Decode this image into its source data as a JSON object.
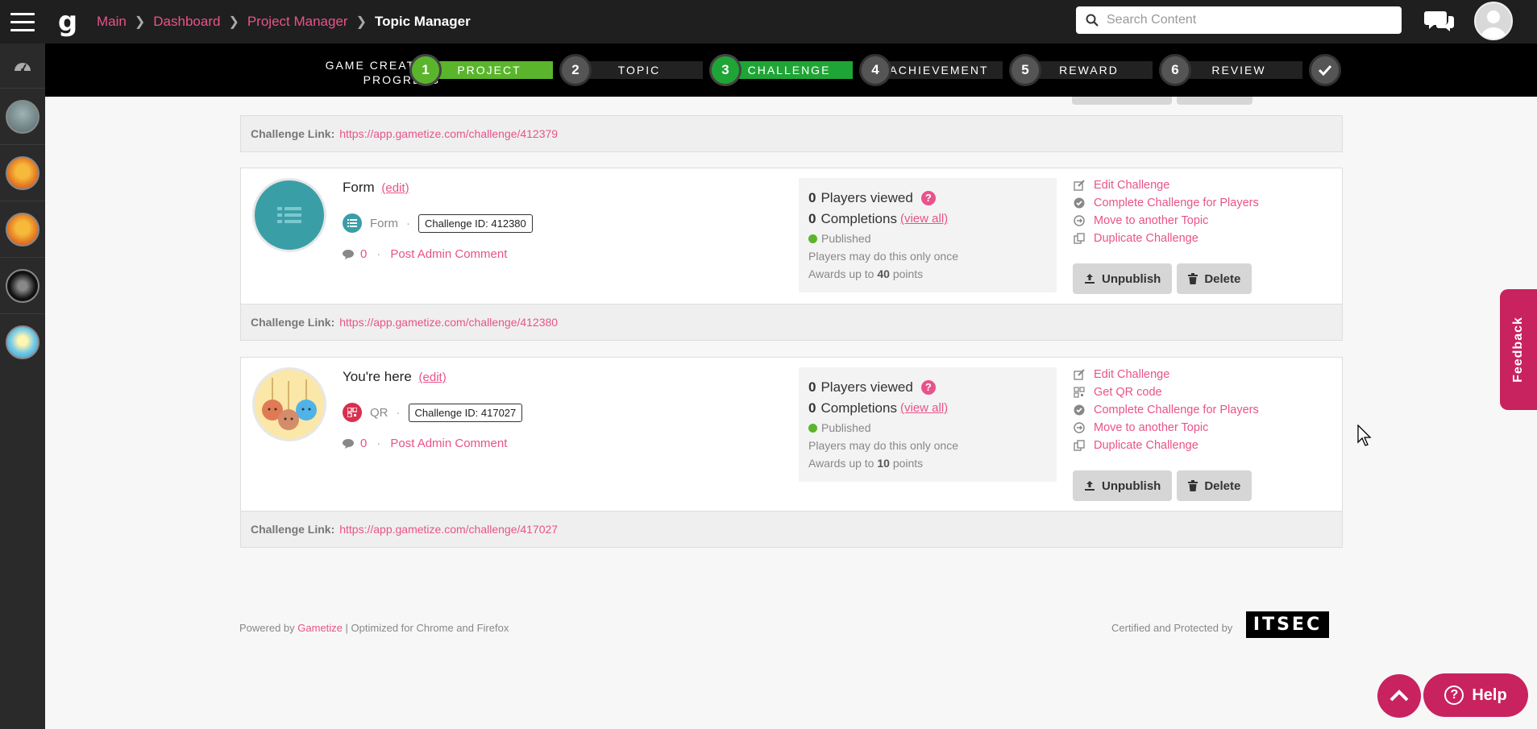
{
  "header": {
    "breadcrumbs": [
      "Main",
      "Dashboard",
      "Project Manager"
    ],
    "current": "Topic Manager",
    "search_placeholder": "Search Content"
  },
  "progress": {
    "label_line1": "GAME CREATION",
    "label_line2": "PROGRESS",
    "steps": [
      {
        "num": "1",
        "label": "PROJECT",
        "state": "done"
      },
      {
        "num": "2",
        "label": "TOPIC",
        "state": "todo"
      },
      {
        "num": "3",
        "label": "CHALLENGE",
        "state": "active"
      },
      {
        "num": "4",
        "label": "ACHIEVEMENT",
        "state": "todo"
      },
      {
        "num": "5",
        "label": "REWARD",
        "state": "todo"
      },
      {
        "num": "6",
        "label": "REVIEW",
        "state": "todo"
      }
    ],
    "final_icon": "check-icon"
  },
  "colors": {
    "accent": "#e8538a",
    "brand": "#c8235e",
    "green": "#5ab52c",
    "active_green": "#1fa535"
  },
  "top_link": {
    "label": "Challenge Link:",
    "url": "https://app.gametize.com/challenge/412379"
  },
  "challenges": [
    {
      "title": "Form",
      "edit": "(edit)",
      "type": "Form",
      "challenge_id": "Challenge ID: 412380",
      "comments": "0",
      "post_comment": "Post Admin Comment",
      "players_viewed_num": "0",
      "players_viewed_label": "Players viewed",
      "completions_num": "0",
      "completions_label": "Completions",
      "view_all": "(view all)",
      "status": "Published",
      "frequency": "Players may do this only once",
      "awards_prefix": "Awards up to",
      "awards_points": "40",
      "awards_suffix": "points",
      "actions": [
        "Edit Challenge",
        "Complete Challenge for Players",
        "Move to another Topic",
        "Duplicate Challenge"
      ],
      "unpublish": "Unpublish",
      "delete": "Delete",
      "link_label": "Challenge Link:",
      "link_url": "https://app.gametize.com/challenge/412380"
    },
    {
      "title": "You're here",
      "edit": "(edit)",
      "type": "QR",
      "challenge_id": "Challenge ID: 417027",
      "comments": "0",
      "post_comment": "Post Admin Comment",
      "players_viewed_num": "0",
      "players_viewed_label": "Players viewed",
      "completions_num": "0",
      "completions_label": "Completions",
      "view_all": "(view all)",
      "status": "Published",
      "frequency": "Players may do this only once",
      "awards_prefix": "Awards up to",
      "awards_points": "10",
      "awards_suffix": "points",
      "actions": [
        "Edit Challenge",
        "Get QR code",
        "Complete Challenge for Players",
        "Move to another Topic",
        "Duplicate Challenge"
      ],
      "unpublish": "Unpublish",
      "delete": "Delete",
      "link_label": "Challenge Link:",
      "link_url": "https://app.gametize.com/challenge/417027"
    }
  ],
  "footer": {
    "powered_by": "Powered by",
    "brand": "Gametize",
    "optimized": "| Optimized for Chrome and Firefox",
    "certified": "Certified and Protected by",
    "itsec": "ITSEC"
  },
  "widgets": {
    "feedback": "Feedback",
    "help": "Help"
  }
}
